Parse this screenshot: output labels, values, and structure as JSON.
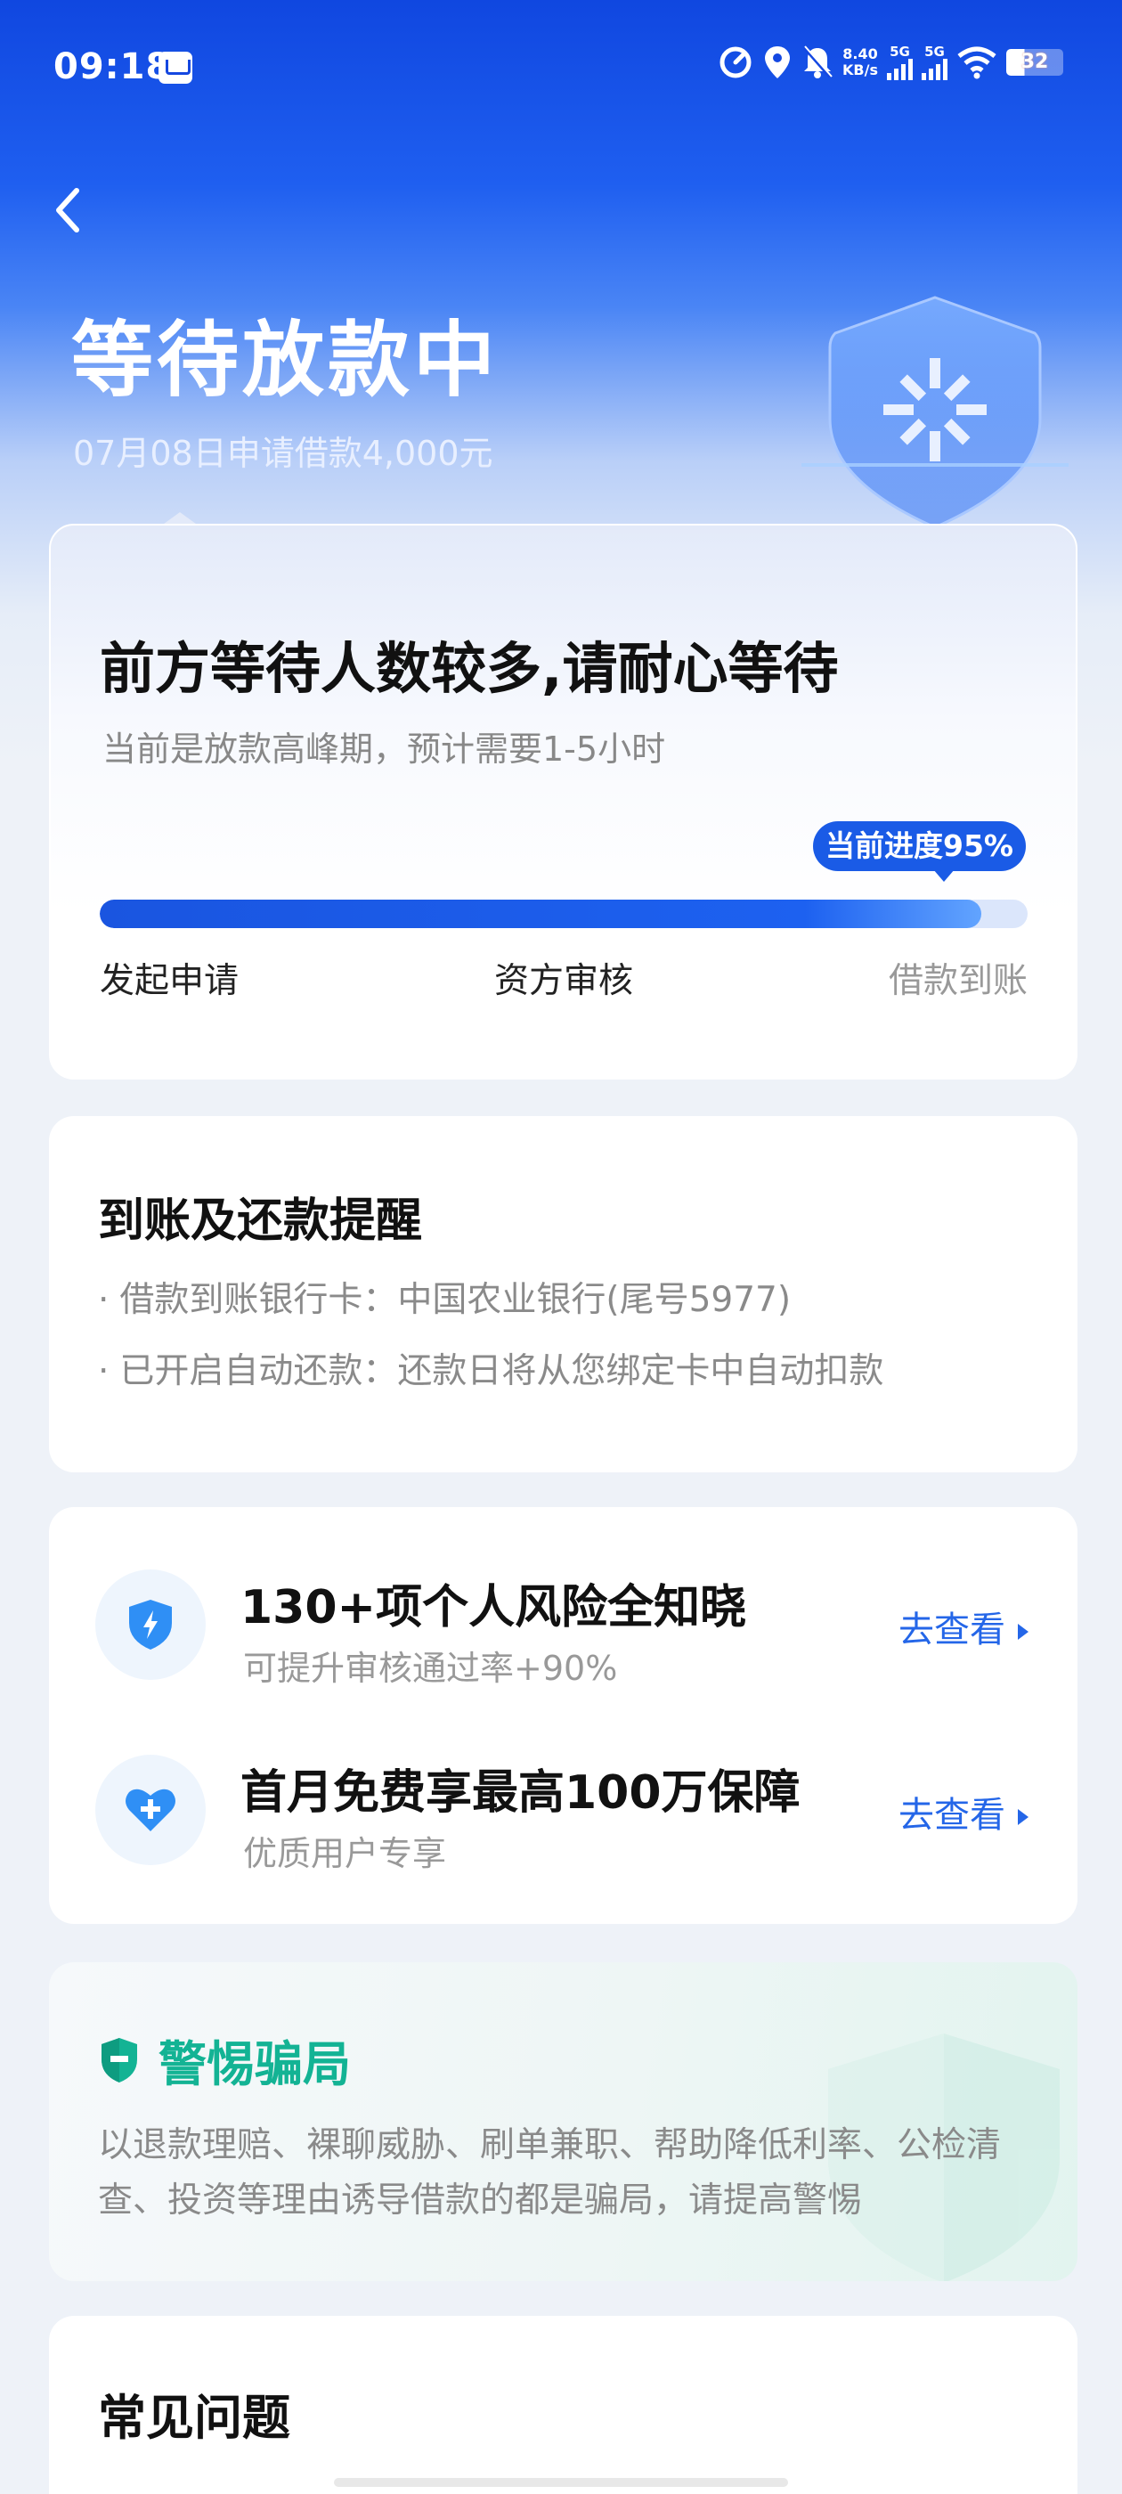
{
  "status_bar": {
    "time": "09:18",
    "net_speed_value": "8.40",
    "net_speed_unit": "KB/s",
    "sim1_label": "5G",
    "sim2_label": "5G",
    "battery": "32"
  },
  "header": {
    "title": "等待放款中",
    "subtitle": "07月08日申请借款4,000元"
  },
  "progress_card": {
    "title": "前方等待人数较多,请耐心等待",
    "subtitle": "当前是放款高峰期，预计需要1-5小时",
    "badge": "当前进度95%",
    "progress_percent": 95,
    "steps": [
      "发起申请",
      "资方审核",
      "借款到账"
    ]
  },
  "reminder_card": {
    "title": "到账及还款提醒",
    "items": [
      "借款到账银行卡：中国农业银行(尾号5977)",
      "已开启自动还款：还款日将从您绑定卡中自动扣款"
    ]
  },
  "promo_card": {
    "items": [
      {
        "title": "130+项个人风险全知晓",
        "subtitle": "可提升审核通过率+90%",
        "link": "去查看",
        "icon": "shield-lightning-icon"
      },
      {
        "title": "首月免费享最高100万保障",
        "subtitle": "优质用户专享",
        "link": "去查看",
        "icon": "heart-plus-icon"
      }
    ]
  },
  "warning_card": {
    "title": "警惕骗局",
    "text": "以退款理赔、裸聊威胁、刷单兼职、帮助降低利率、公检清查、投资等理由诱导借款的都是骗局，请提高警惕"
  },
  "faq_card": {
    "title": "常见问题"
  },
  "colors": {
    "primary": "#1a5be6",
    "warning_green": "#13b394",
    "header_blue": "#1047e0"
  }
}
